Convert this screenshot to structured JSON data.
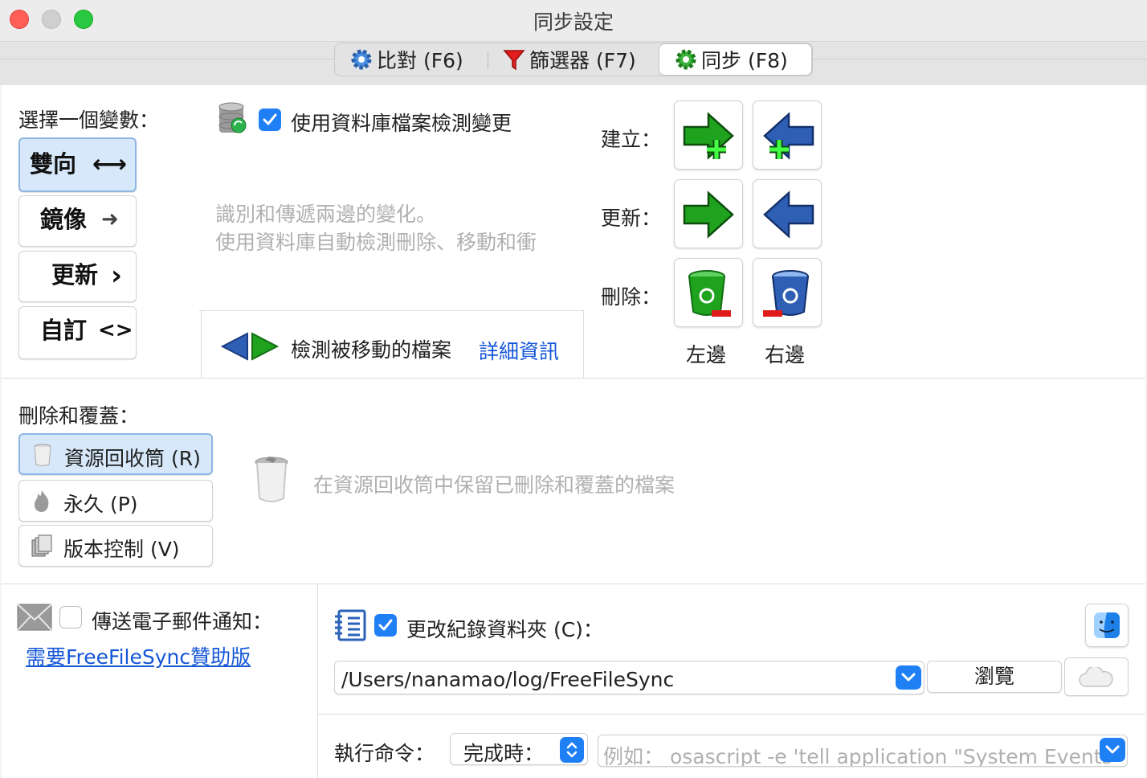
{
  "window": {
    "title": "同步設定"
  },
  "tabs": [
    {
      "label": "比對 (F6)",
      "selected": false
    },
    {
      "label": "篩選器 (F7)",
      "selected": false
    },
    {
      "label": "同步 (F8)",
      "selected": true
    }
  ],
  "variant": {
    "heading": "選擇一個變數：",
    "options": [
      {
        "label": "雙向",
        "symbol": "⟷",
        "selected": true
      },
      {
        "label": "鏡像",
        "symbol": "➜",
        "selected": false
      },
      {
        "label": "更新",
        "symbol": "›",
        "selected": false
      },
      {
        "label": "自訂",
        "symbol": "<>",
        "selected": false
      }
    ]
  },
  "database": {
    "checkbox_label": "使用資料庫檔案檢測變更",
    "checked": true,
    "description_line1": "識別和傳遞兩邊的變化。",
    "description_line2": "使用資料庫自動檢測刪除、移動和衝",
    "moved_files_label": "檢測被移動的檔案",
    "details_link": "詳細資訊"
  },
  "actions": {
    "create_label": "建立：",
    "update_label": "更新：",
    "delete_label": "刪除：",
    "left_label": "左邊",
    "right_label": "右邊"
  },
  "deletion": {
    "heading": "刪除和覆蓋：",
    "options": [
      {
        "label": "資源回收筒 (R)",
        "icon": "trash-icon",
        "selected": true
      },
      {
        "label": "永久 (P)",
        "icon": "flame-icon",
        "selected": false
      },
      {
        "label": "版本控制 (V)",
        "icon": "versioning-icon",
        "selected": false
      }
    ],
    "description": "在資源回收筒中保留已刪除和覆蓋的檔案"
  },
  "email": {
    "checkbox_label": "傳送電子郵件通知：",
    "checked": false,
    "sponsor_link": "需要FreeFileSync贊助版"
  },
  "log": {
    "checkbox_label": "更改紀錄資料夾 (C)：",
    "checked": true,
    "path": "/Users/nanamao/log/FreeFileSync",
    "browse_label": "瀏覽"
  },
  "command": {
    "label": "執行命令：",
    "when_value": "完成時：",
    "placeholder": "例如： osascript -e 'tell application \"System Events"
  },
  "colors": {
    "accent": "#1f7ff5",
    "link": "#1456d8",
    "selection": "#d6e8f9",
    "green_arrow": "#1fa31f",
    "blue_arrow": "#2f5fb5"
  }
}
